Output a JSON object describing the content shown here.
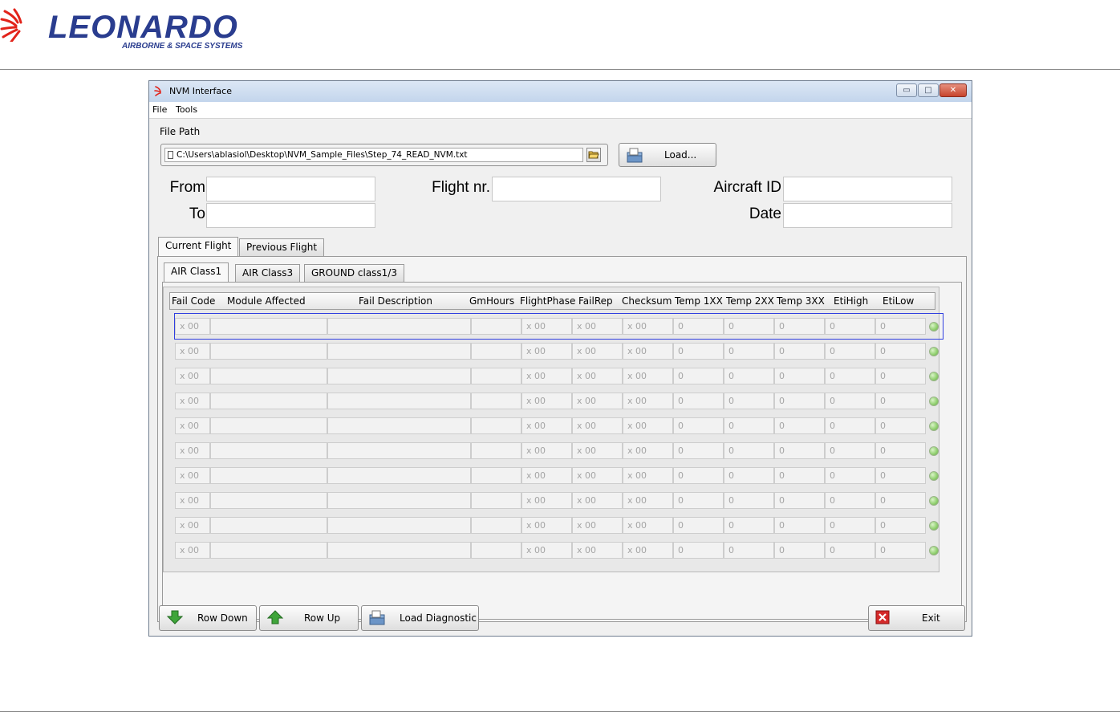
{
  "brand": {
    "name": "LEONARDO",
    "tagline": "AIRBORNE & SPACE SYSTEMS",
    "color": "#2a3d8f",
    "accent": "#e2231a"
  },
  "window": {
    "title": "NVM Interface",
    "controls": {
      "minimize": "▭",
      "maximize": "□",
      "close": "✕"
    }
  },
  "menu": [
    "File",
    "Tools"
  ],
  "file_path": {
    "label": "File Path",
    "value": "C:\\Users\\ablasiol\\Desktop\\NVM_Sample_Files\\Step_74_READ_NVM.txt",
    "load_label": "Load..."
  },
  "fields": {
    "from_label": "From",
    "to_label": "To",
    "flight_label": "Flight nr.",
    "aircraft_label": "Aircraft ID",
    "date_label": "Date",
    "from_value": "",
    "to_value": "",
    "flight_value": "",
    "aircraft_value": "",
    "date_value": ""
  },
  "tabs": [
    "Current Flight",
    "Previous Flight"
  ],
  "subtabs": [
    "AIR Class1",
    "AIR Class3",
    "GROUND class1/3"
  ],
  "columns": [
    "Fail Code",
    "Module Affected",
    "Fail Description",
    "GmHours",
    "FlightPhase",
    "FailRep",
    "Checksum",
    "Temp 1XX",
    "Temp 2XX",
    "Temp 3XX",
    "EtiHigh",
    "EtiLow"
  ],
  "rows": [
    [
      "x  00",
      "",
      "",
      "",
      "x  00",
      "x  00",
      "x  00",
      "0",
      "0",
      "0",
      "0",
      "0"
    ],
    [
      "x  00",
      "",
      "",
      "",
      "x  00",
      "x  00",
      "x  00",
      "0",
      "0",
      "0",
      "0",
      "0"
    ],
    [
      "x  00",
      "",
      "",
      "",
      "x  00",
      "x  00",
      "x  00",
      "0",
      "0",
      "0",
      "0",
      "0"
    ],
    [
      "x  00",
      "",
      "",
      "",
      "x  00",
      "x  00",
      "x  00",
      "0",
      "0",
      "0",
      "0",
      "0"
    ],
    [
      "x  00",
      "",
      "",
      "",
      "x  00",
      "x  00",
      "x  00",
      "0",
      "0",
      "0",
      "0",
      "0"
    ],
    [
      "x  00",
      "",
      "",
      "",
      "x  00",
      "x  00",
      "x  00",
      "0",
      "0",
      "0",
      "0",
      "0"
    ],
    [
      "x  00",
      "",
      "",
      "",
      "x  00",
      "x  00",
      "x  00",
      "0",
      "0",
      "0",
      "0",
      "0"
    ],
    [
      "x  00",
      "",
      "",
      "",
      "x  00",
      "x  00",
      "x  00",
      "0",
      "0",
      "0",
      "0",
      "0"
    ],
    [
      "x  00",
      "",
      "",
      "",
      "x  00",
      "x  00",
      "x  00",
      "0",
      "0",
      "0",
      "0",
      "0"
    ],
    [
      "x  00",
      "",
      "",
      "",
      "x  00",
      "x  00",
      "x  00",
      "0",
      "0",
      "0",
      "0",
      "0"
    ]
  ],
  "buttons": {
    "row_down": "Row Down",
    "row_up": "Row Up",
    "load_diagnostic": "Load Diagnostic",
    "exit": "Exit"
  },
  "colors": {
    "status_led": "#8fcf6d",
    "selection": "#2f3ee0",
    "exit_icon": "#d42a2a",
    "arrow_icon": "#3fa53a"
  }
}
